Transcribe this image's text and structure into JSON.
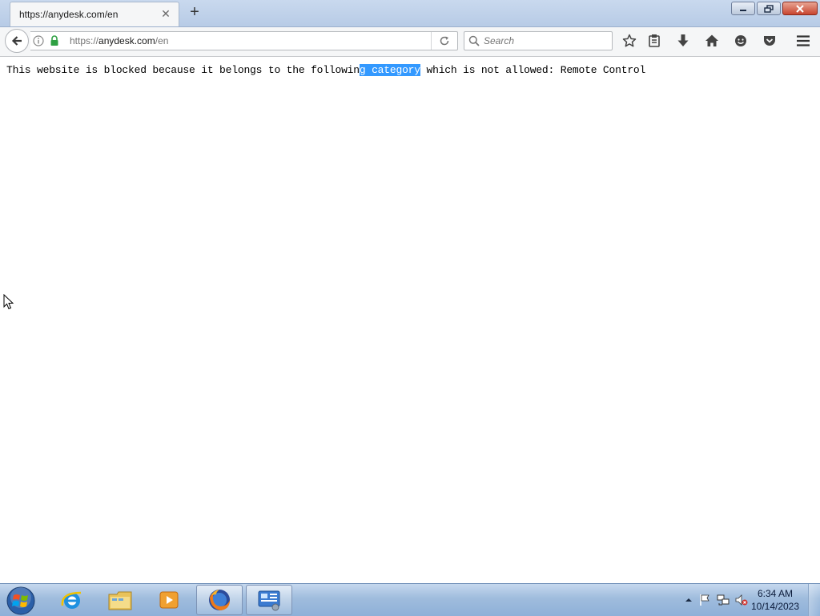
{
  "browser": {
    "tab": {
      "title": "https://anydesk.com/en",
      "close_glyph": "✕"
    },
    "new_tab_glyph": "+",
    "address": {
      "prefix": "https://",
      "host": "anydesk.com",
      "path": "/en"
    },
    "search": {
      "placeholder": "Search"
    },
    "toolbar_icons": [
      "bookmark-star-icon",
      "reading-list-icon",
      "download-icon",
      "home-icon",
      "hello-icon",
      "pocket-icon",
      "menu-icon"
    ]
  },
  "page": {
    "message_before": "This website is blocked because it belongs to the followin",
    "message_selected": "g category",
    "message_after": " which is not allowed: Remote Control"
  },
  "taskbar": {
    "apps": [
      "internet-explorer-icon",
      "windows-explorer-icon",
      "media-player-icon",
      "firefox-icon",
      "control-panel-icon"
    ],
    "clock": {
      "time": "6:34 AM",
      "date": "10/14/2023"
    }
  },
  "colors": {
    "selection": "#3399ff",
    "taskbar": "#9fbcdd",
    "close_button": "#c8452f"
  }
}
